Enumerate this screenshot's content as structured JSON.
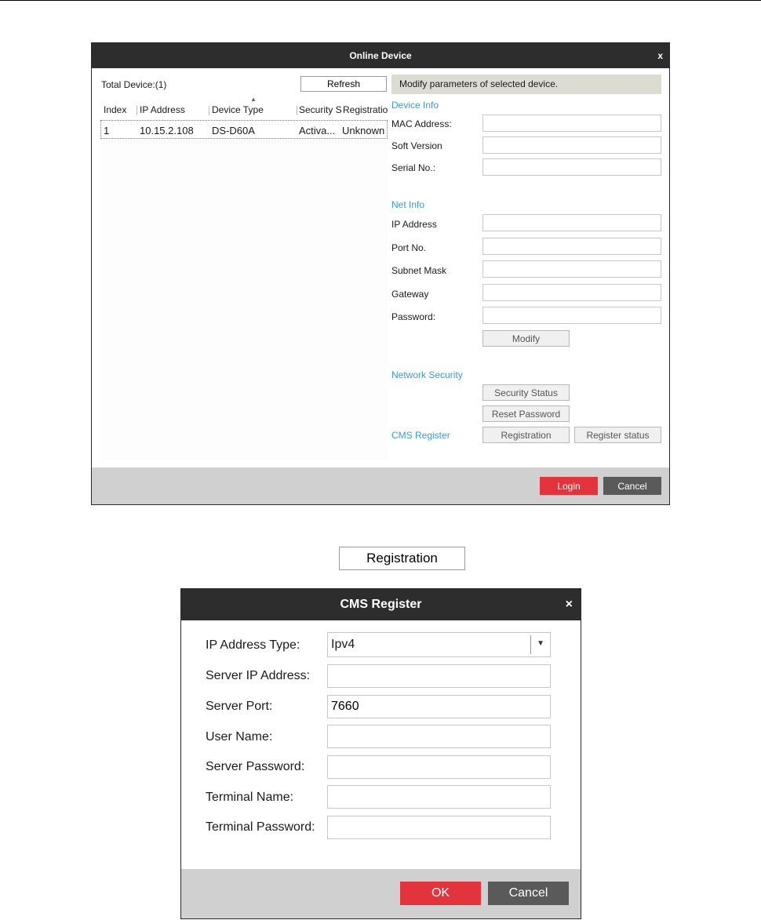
{
  "online_device": {
    "title": "Online Device",
    "close_glyph": "x",
    "total_label": "Total Device:(1)",
    "refresh_label": "Refresh",
    "columns": [
      "Index",
      "IP Address",
      "Device Type",
      "Security S",
      "Registration"
    ],
    "rows": [
      {
        "index": "1",
        "ip": "10.15.2.108",
        "type": "DS-D60A",
        "security": "Activa...",
        "registration": "Unknown"
      }
    ],
    "modify_hint": "Modify parameters of selected device.",
    "sections": {
      "device_info": "Device Info",
      "net_info": "Net Info",
      "network_security": "Network Security",
      "cms_register": "CMS Register"
    },
    "fields": {
      "mac": {
        "label": "MAC Address:",
        "value": ""
      },
      "soft": {
        "label": "Soft Version",
        "value": ""
      },
      "serial": {
        "label": "Serial No.:",
        "value": ""
      },
      "ip": {
        "label": "IP Address",
        "value": ""
      },
      "port": {
        "label": "Port No.",
        "value": ""
      },
      "mask": {
        "label": "Subnet Mask",
        "value": ""
      },
      "gateway": {
        "label": "Gateway",
        "value": ""
      },
      "password": {
        "label": "Password:",
        "value": ""
      }
    },
    "buttons": {
      "modify": "Modify",
      "security_status": "Security Status",
      "reset_password": "Reset Password",
      "registration": "Registration",
      "register_status": "Register status",
      "login": "Login",
      "cancel": "Cancel"
    }
  },
  "standalone_button": "Registration",
  "cms_register": {
    "title": "CMS Register",
    "close_glyph": "×",
    "fields": {
      "ip_type": {
        "label": "IP Address Type:",
        "value": "Ipv4"
      },
      "server_ip": {
        "label": "Server IP Address:",
        "value": ""
      },
      "server_port": {
        "label": "Server Port:",
        "value": "7660"
      },
      "user_name": {
        "label": "User Name:",
        "value": ""
      },
      "server_password": {
        "label": "Server Password:",
        "value": ""
      },
      "terminal_name": {
        "label": "Terminal Name:",
        "value": ""
      },
      "terminal_password": {
        "label": "Terminal Password:",
        "value": ""
      }
    },
    "buttons": {
      "ok": "OK",
      "cancel": "Cancel"
    }
  },
  "colors": {
    "titlebar": "#2d2d2d",
    "accent_red": "#e3343e",
    "section_blue": "#3a9ad9",
    "footer_gray": "#d0d0d0"
  }
}
